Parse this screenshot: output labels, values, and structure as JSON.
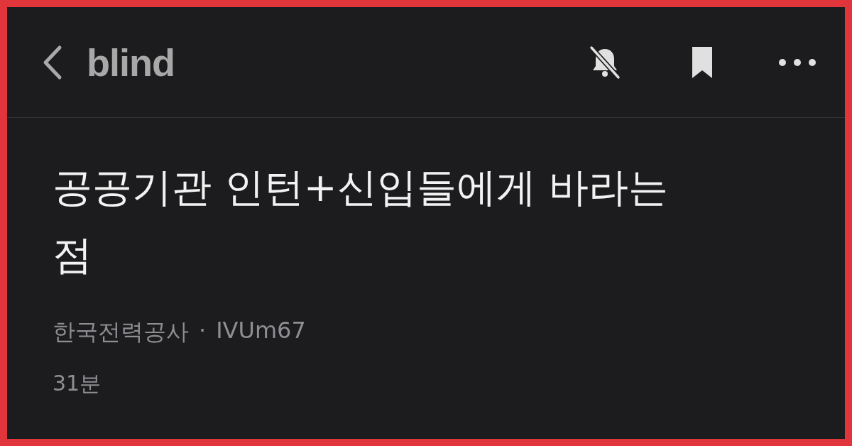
{
  "header": {
    "logo": "blind",
    "notifications_muted": true
  },
  "post": {
    "title": "공공기관 인턴+신입들에게 바라는 점",
    "company": "한국전력공사",
    "separator": "·",
    "nickname": "IVUm67",
    "time": "31분"
  }
}
